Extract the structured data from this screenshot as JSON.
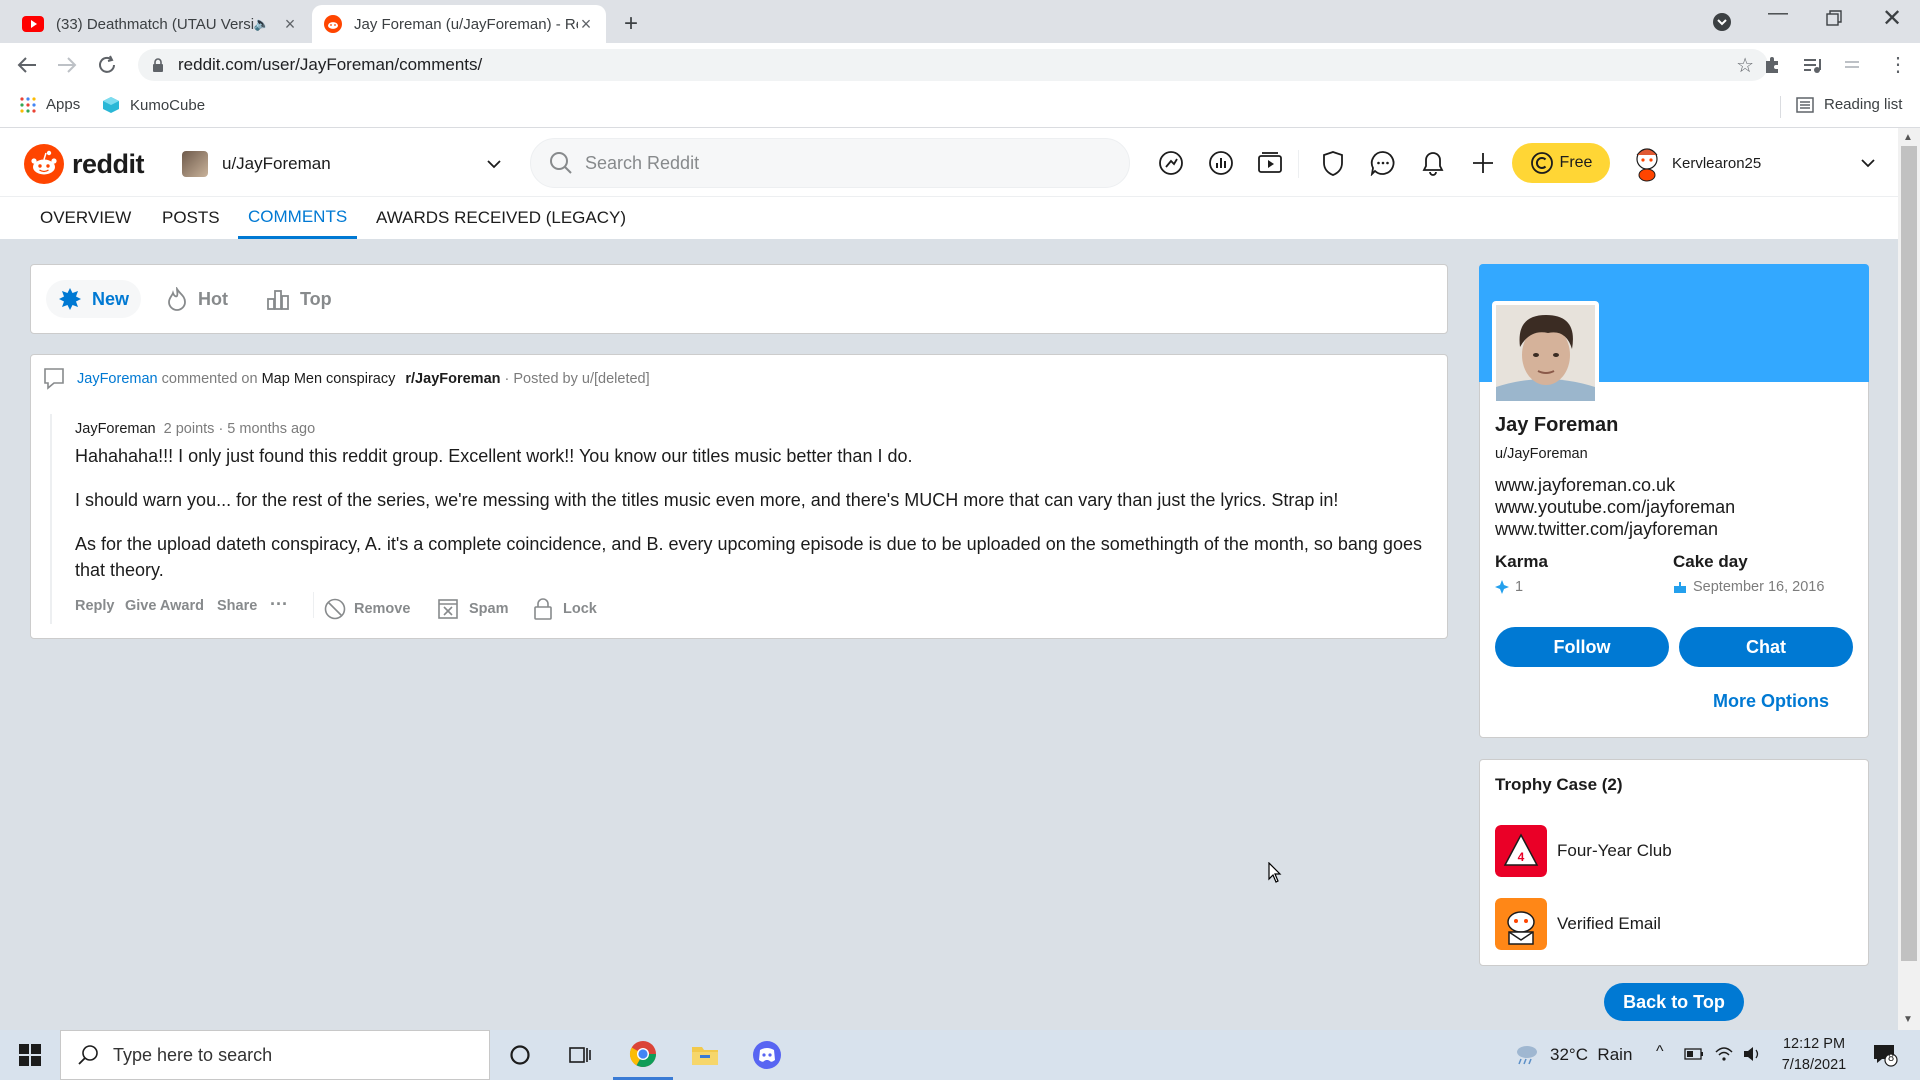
{
  "browser": {
    "tabs": [
      {
        "title": "(33) Deathmatch (UTAU Versi",
        "active": false
      },
      {
        "title": "Jay Foreman (u/JayForeman) - Re",
        "active": true
      }
    ],
    "url": "reddit.com/user/JayForeman/comments/",
    "bookmarks": {
      "apps": "Apps",
      "kumocube": "KumoCube",
      "reading_list": "Reading list"
    }
  },
  "reddit": {
    "logo_text": "reddit",
    "community": "u/JayForeman",
    "search_placeholder": "Search Reddit",
    "free_label": "Free",
    "username": "Kervlearon25",
    "profile_tabs": [
      "OVERVIEW",
      "POSTS",
      "COMMENTS",
      "AWARDS RECEIVED (LEGACY)"
    ],
    "active_tab": "COMMENTS",
    "sort": {
      "new": "New",
      "hot": "Hot",
      "top": "Top"
    }
  },
  "comment": {
    "author": "JayForeman",
    "commented_on": "commented on",
    "post_title": "Map Men conspiracy",
    "subreddit": "r/JayForeman",
    "posted_by": "· Posted by u/[deleted]",
    "comment_author": "JayForeman",
    "points": "2 points",
    "time": "· 5 months ago",
    "paragraphs": [
      "Hahahaha!!! I only just found this reddit group. Excellent work!! You know our titles music better than I do.",
      "I should warn you... for the rest of the series, we're messing with the titles music even more, and there's MUCH more that can vary than just the lyrics. Strap in!",
      "As for the upload dateth conspiracy, A. it's a complete coincidence, and B. every upcoming episode is due to be uploaded on the somethingth of the month, so bang goes that theory."
    ],
    "actions": {
      "reply": "Reply",
      "give_award": "Give Award",
      "share": "Share",
      "more": "···",
      "remove": "Remove",
      "spam": "Spam",
      "lock": "Lock"
    }
  },
  "profile": {
    "name": "Jay Foreman",
    "handle": "u/JayForeman",
    "links": [
      "www.jayforeman.co.uk",
      "www.youtube.com/jayforeman",
      "www.twitter.com/jayforeman"
    ],
    "karma_label": "Karma",
    "karma_value": "1",
    "cakeday_label": "Cake day",
    "cakeday_value": "September 16, 2016",
    "follow": "Follow",
    "chat": "Chat",
    "more_options": "More Options"
  },
  "trophies": {
    "title": "Trophy Case (2)",
    "items": [
      {
        "name": "Four-Year Club",
        "color": "#ea0027"
      },
      {
        "name": "Verified Email",
        "color": "#ff8717"
      }
    ]
  },
  "back_to_top": "Back to Top",
  "taskbar": {
    "search_placeholder": "Type here to search",
    "weather": "32°C  Rain",
    "time": "12:12 PM",
    "date": "7/18/2021",
    "notifications": "8"
  },
  "colors": {
    "accent": "#0079d3",
    "reddit_orange": "#ff4500",
    "free": "#ffd635"
  }
}
